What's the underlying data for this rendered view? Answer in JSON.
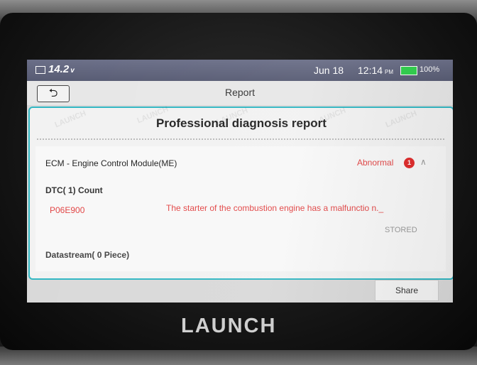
{
  "status_bar": {
    "voltage": "14.2",
    "voltage_unit": "v",
    "date": "Jun 18",
    "time": "12:14",
    "time_suffix": "PM",
    "battery_percent": "100%"
  },
  "header": {
    "title": "Report",
    "back_icon": "back-arrow-icon"
  },
  "report": {
    "title": "Professional diagnosis report",
    "module": {
      "name": "ECM - Engine Control Module(ME)",
      "status": "Abnormal",
      "fault_count": "1",
      "expand_icon": "chevron-up-icon"
    },
    "dtc_header": "DTC( 1) Count",
    "dtcs": [
      {
        "code": "P06E900",
        "description": "The starter of the combustion engine has a malfunctio n._",
        "status": "STORED"
      }
    ],
    "datastream_header": "Datastream( 0 Piece)"
  },
  "actions": {
    "share_label": "Share"
  },
  "device": {
    "brand": "LAUNCH"
  },
  "watermark_text": "LAUNCH",
  "colors": {
    "accent": "#31b7c3",
    "error": "#e24545",
    "status_bar": "#5d6179",
    "battery": "#2fd04c"
  }
}
